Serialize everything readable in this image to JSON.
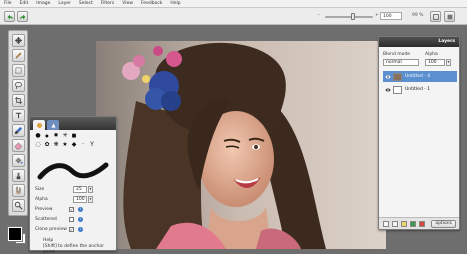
{
  "menu": [
    "File",
    "Edit",
    "Image",
    "Layer",
    "Select",
    "Filters",
    "View",
    "Feedback",
    "Help"
  ],
  "toolbar": {
    "zoom_value": "100",
    "zoom_percent": "99 %",
    "zoom_level": 0.6
  },
  "brush_panel": {
    "shape_glyphs": [
      "●",
      "●",
      "✸",
      "✳",
      "■",
      "◌",
      "✿",
      "❋",
      "★",
      "◆",
      "·",
      "Y"
    ],
    "size_label": "Size",
    "size_value": "25",
    "alpha_label": "Alpha",
    "alpha_value": "100",
    "preview_label": "Preview",
    "scattered_label": "Scattered",
    "clone_preview_label": "Clone preview",
    "help_title": "Help",
    "help_text": "[Shift] to define the anchor point"
  },
  "layers_panel": {
    "title": "Layers",
    "blend_mode_label": "Blend mode",
    "blend_mode_value": "normal",
    "alpha_label": "Alpha",
    "alpha_value": "100",
    "layers": [
      {
        "name": "Untitled - 4"
      },
      {
        "name": "Untitled - 1"
      }
    ],
    "options_label": "options"
  },
  "colors": {
    "foreground": "#000000",
    "background": "#ffffff",
    "panel_header": "#333333",
    "layer_selected": "#5a8fd0"
  }
}
